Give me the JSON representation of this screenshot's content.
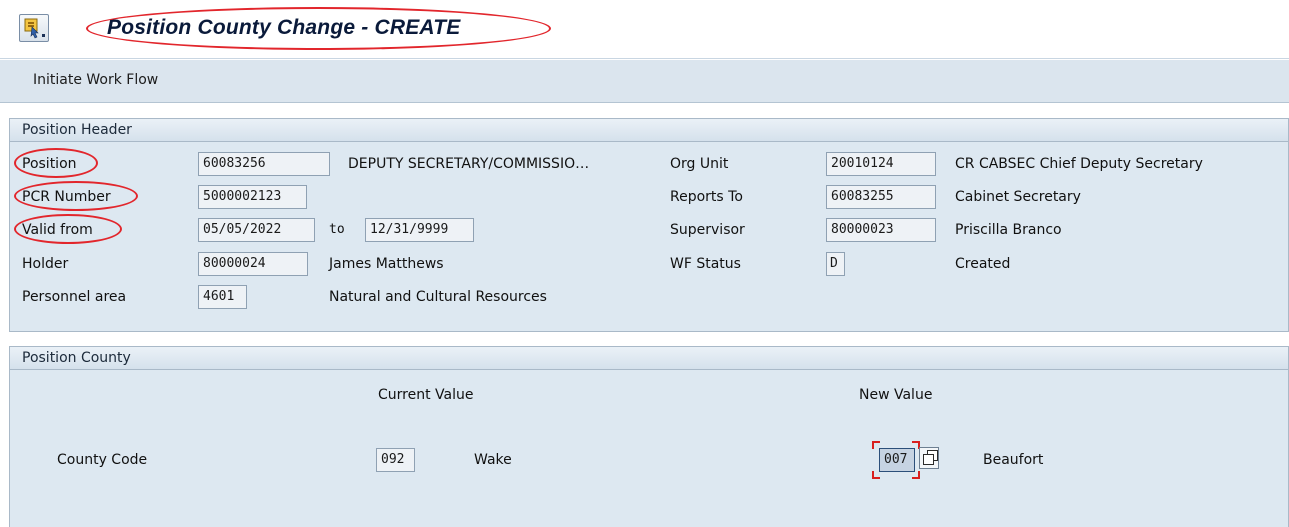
{
  "title": "Position County Change - CREATE",
  "toolbar": {
    "initiate_workflow": "Initiate Work Flow"
  },
  "header": {
    "section_title": "Position Header",
    "position": {
      "label": "Position",
      "value": "60083256",
      "text": "DEPUTY SECRETARY/COMMISSIO…"
    },
    "pcr_number": {
      "label": "PCR Number",
      "value": "5000002123"
    },
    "valid_from": {
      "label": "Valid from",
      "value": "05/05/2022",
      "to_label": "to",
      "to_value": "12/31/9999"
    },
    "holder": {
      "label": "Holder",
      "value": "80000024",
      "text": "James Matthews"
    },
    "personnel_area": {
      "label": "Personnel area",
      "value": "4601",
      "text": "Natural and Cultural Resources"
    },
    "org_unit": {
      "label": "Org Unit",
      "value": "20010124",
      "text": "CR CABSEC Chief Deputy Secretary"
    },
    "reports_to": {
      "label": "Reports To",
      "value": "60083255",
      "text": "Cabinet Secretary"
    },
    "supervisor": {
      "label": "Supervisor",
      "value": "80000023",
      "text": "Priscilla Branco"
    },
    "wf_status": {
      "label": "WF Status",
      "value": "D",
      "text": "Created"
    }
  },
  "county": {
    "section_title": "Position County",
    "current_header": "Current Value",
    "new_header": "New Value",
    "code_label": "County Code",
    "current_code": "092",
    "current_name": "Wake",
    "new_code": "007",
    "new_name": "Beaufort"
  },
  "icons": {
    "menu": "sap-menu-icon",
    "f4": "value-help-icon"
  },
  "colors": {
    "highlight_oval": "#e2262c",
    "toolbar_bg": "#dbe5ee",
    "group_bg": "#dde8f1"
  }
}
